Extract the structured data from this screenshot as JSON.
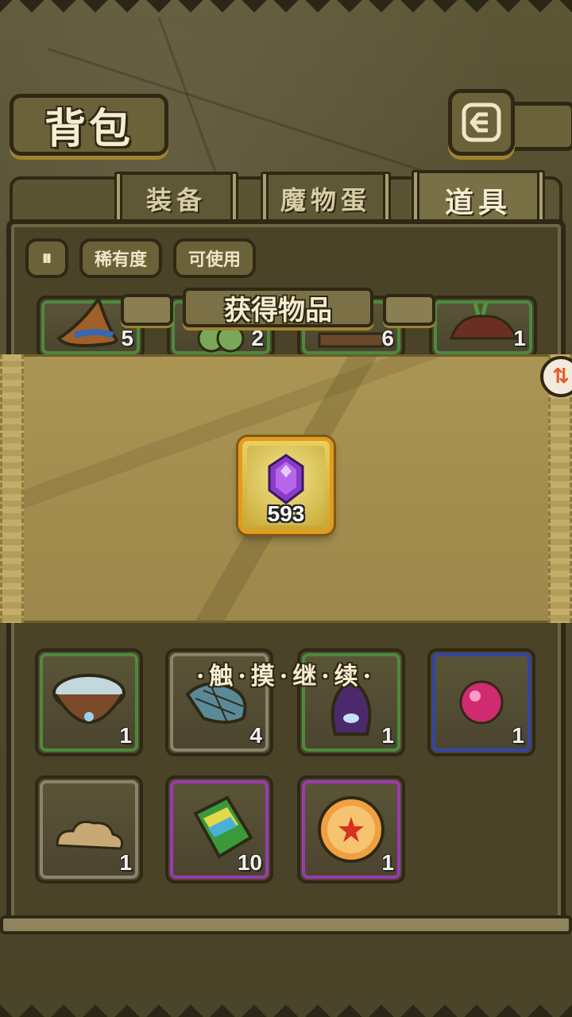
{
  "header": {
    "title": "背包",
    "back_icon": "back-arrow-icon"
  },
  "tabs": [
    {
      "label": "装备",
      "active": false
    },
    {
      "label": "魔物蛋",
      "active": false
    },
    {
      "label": "道具",
      "active": true
    }
  ],
  "filters": {
    "toggle_icon": "pause-icon",
    "toggle_label": "⏸",
    "rarity_label": "稀有度",
    "usable_label": "可使用"
  },
  "top_row_items": [
    {
      "icon": "wizard-hat-icon",
      "count": "5"
    },
    {
      "icon": "clover-icon",
      "count": "2"
    },
    {
      "icon": "plank-icon",
      "count": "6"
    },
    {
      "icon": "dirt-pile-icon",
      "count": "1"
    }
  ],
  "grid_items": [
    {
      "icon": "bowl-icon",
      "count": "1",
      "rarity": "green"
    },
    {
      "icon": "fish-net-icon",
      "count": "4",
      "rarity": "gray"
    },
    {
      "icon": "tentacle-monster-icon",
      "count": "1",
      "rarity": "green"
    },
    {
      "icon": "pink-orb-icon",
      "count": "1",
      "rarity": "blue"
    },
    {
      "icon": "cloud-stone-icon",
      "count": "1",
      "rarity": "gray"
    },
    {
      "icon": "book-icon",
      "count": "10",
      "rarity": "purple"
    },
    {
      "icon": "star-ball-icon",
      "count": "1",
      "rarity": "purple"
    }
  ],
  "popup": {
    "title": "获得物品",
    "reward": {
      "icon": "purple-gem-icon",
      "count": "593"
    },
    "continue_text": "·触·摸·继·续·"
  },
  "side_badge_icon": "up-down-arrow-icon",
  "colors": {
    "background": "#4e482c",
    "border": "#2e2814",
    "gold": "#e49a1c",
    "rarity_green": "#4c8a3c",
    "rarity_blue": "#3344aa",
    "rarity_purple": "#9a3ab0"
  }
}
